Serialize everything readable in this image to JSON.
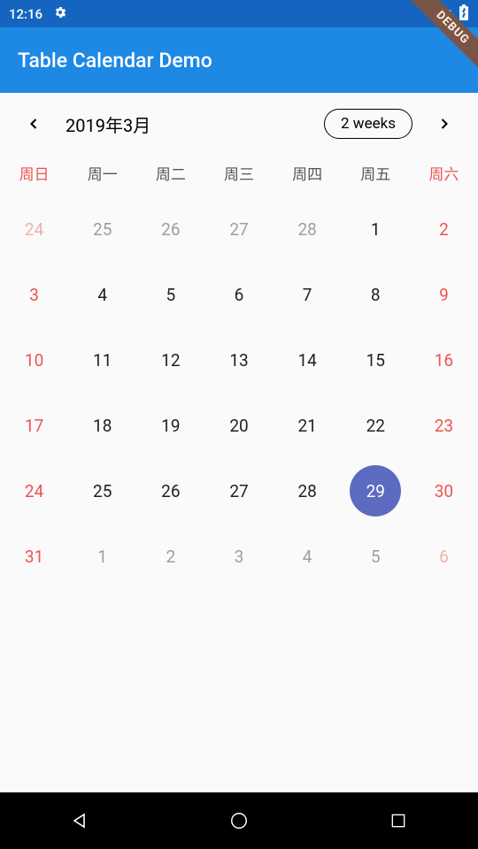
{
  "status": {
    "time": "12:16",
    "settings_icon": "gear-icon",
    "wifi_icon": "wifi-icon",
    "battery_icon": "battery-charging-icon"
  },
  "debug_banner": "DEBUG",
  "app_bar": {
    "title": "Table Calendar Demo"
  },
  "calendar_header": {
    "month_title": "2019年3月",
    "format_label": "2 weeks"
  },
  "days_of_week": [
    "周日",
    "周一",
    "周二",
    "周三",
    "周四",
    "周五",
    "周六"
  ],
  "weeks": [
    [
      {
        "d": "24",
        "out": true,
        "we": true
      },
      {
        "d": "25",
        "out": true
      },
      {
        "d": "26",
        "out": true
      },
      {
        "d": "27",
        "out": true
      },
      {
        "d": "28",
        "out": true
      },
      {
        "d": "1"
      },
      {
        "d": "2",
        "we": true
      }
    ],
    [
      {
        "d": "3",
        "we": true
      },
      {
        "d": "4"
      },
      {
        "d": "5"
      },
      {
        "d": "6"
      },
      {
        "d": "7"
      },
      {
        "d": "8"
      },
      {
        "d": "9",
        "we": true
      }
    ],
    [
      {
        "d": "10",
        "we": true
      },
      {
        "d": "11"
      },
      {
        "d": "12"
      },
      {
        "d": "13"
      },
      {
        "d": "14"
      },
      {
        "d": "15"
      },
      {
        "d": "16",
        "we": true
      }
    ],
    [
      {
        "d": "17",
        "we": true
      },
      {
        "d": "18"
      },
      {
        "d": "19"
      },
      {
        "d": "20"
      },
      {
        "d": "21"
      },
      {
        "d": "22"
      },
      {
        "d": "23",
        "we": true
      }
    ],
    [
      {
        "d": "24",
        "we": true
      },
      {
        "d": "25"
      },
      {
        "d": "26"
      },
      {
        "d": "27"
      },
      {
        "d": "28"
      },
      {
        "d": "29",
        "sel": true
      },
      {
        "d": "30",
        "we": true
      }
    ],
    [
      {
        "d": "31",
        "we": true
      },
      {
        "d": "1",
        "out": true
      },
      {
        "d": "2",
        "out": true
      },
      {
        "d": "3",
        "out": true
      },
      {
        "d": "4",
        "out": true
      },
      {
        "d": "5",
        "out": true
      },
      {
        "d": "6",
        "out": true,
        "we": true
      }
    ]
  ]
}
